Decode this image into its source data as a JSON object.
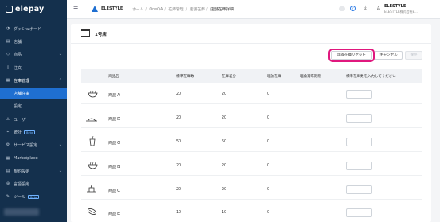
{
  "sidebar": {
    "logo": "elepay",
    "items": [
      {
        "label": "ダッシュボード",
        "icon": "clock-icon"
      },
      {
        "label": "店舗",
        "icon": "store-icon"
      },
      {
        "label": "商品",
        "icon": "tag-icon"
      },
      {
        "label": "注文",
        "icon": "document-icon"
      },
      {
        "label": "在庫管理",
        "icon": "boxes-icon"
      },
      {
        "label": "店舗在庫",
        "icon": ""
      },
      {
        "label": "設定",
        "icon": ""
      },
      {
        "label": "ユーザー",
        "icon": "user-icon"
      },
      {
        "label": "統計",
        "icon": "chart-icon",
        "badge": "Beta"
      },
      {
        "label": "サービス設定",
        "icon": "gear-icon"
      },
      {
        "label": "Marketplace",
        "icon": "grid-icon"
      },
      {
        "label": "規約設定",
        "icon": "file-icon"
      },
      {
        "label": "言語設定",
        "icon": "globe-icon"
      },
      {
        "label": "ツール",
        "icon": "wrench-icon",
        "badge": "Beta"
      }
    ]
  },
  "header": {
    "brand": "ELESTYLE",
    "breadcrumb": [
      "ホーム",
      "OneQA",
      "在庫管理",
      "店舗在庫",
      "店舗在庫詳細"
    ],
    "user_name": "ELESTYLE",
    "user_company": "ELESTYLE株式会社E..."
  },
  "store": {
    "title": "1号店"
  },
  "actions": {
    "reset": "理論在庫リセット",
    "cancel": "キャンセル",
    "save": "保存"
  },
  "table": {
    "columns": [
      "商品名",
      "標準在庫数",
      "在庫差分",
      "理論在庫",
      "理論賞味期限",
      "標準在庫数を入力してください"
    ],
    "rows": [
      {
        "name": "商品 A",
        "standard": "20",
        "diff": "20",
        "theory": "0",
        "icon": "bowl-icon"
      },
      {
        "name": "商品 D",
        "standard": "20",
        "diff": "20",
        "theory": "0",
        "icon": "dish-icon"
      },
      {
        "name": "商品 G",
        "standard": "50",
        "diff": "50",
        "theory": "0",
        "icon": "cup-icon"
      },
      {
        "name": "商品 B",
        "standard": "20",
        "diff": "20",
        "theory": "0",
        "icon": "bowl-icon"
      },
      {
        "name": "商品 C",
        "standard": "20",
        "diff": "20",
        "theory": "0",
        "icon": "dish-icon"
      },
      {
        "name": "商品 E",
        "standard": "10",
        "diff": "10",
        "theory": "0",
        "icon": "sushi-icon"
      }
    ]
  }
}
